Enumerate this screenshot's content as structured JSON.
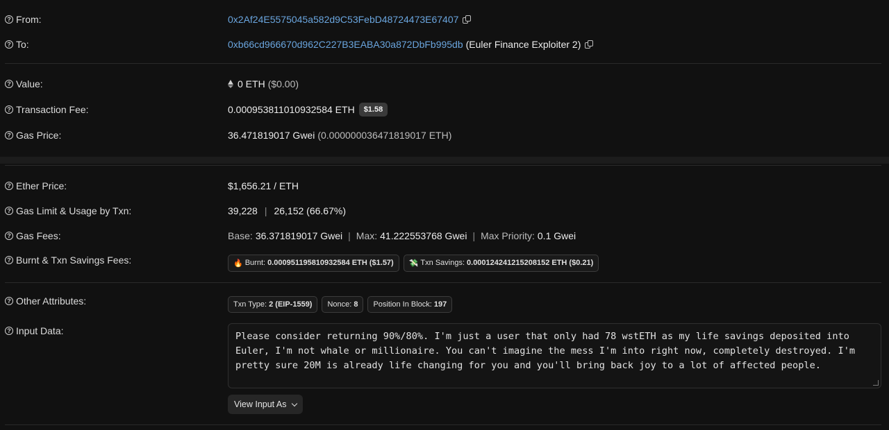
{
  "from": {
    "label": "From:",
    "address": "0x2Af24E5575045a582d9C53FebD48724473E67407"
  },
  "to": {
    "label": "To:",
    "address": "0xb66cd966670d962C227B3EABA30a872DbFb995db",
    "name": "(Euler Finance Exploiter 2)"
  },
  "value": {
    "label": "Value:",
    "amount": "0 ETH",
    "usd": "($0.00)"
  },
  "fee": {
    "label": "Transaction Fee:",
    "amount": "0.000953811010932584 ETH",
    "usd": "$1.58"
  },
  "gas_price": {
    "label": "Gas Price:",
    "gwei": "36.471819017 Gwei",
    "eth": "(0.000000036471819017 ETH)"
  },
  "ether_price": {
    "label": "Ether Price:",
    "value": "$1,656.21 / ETH"
  },
  "gas_limit": {
    "label": "Gas Limit & Usage by Txn:",
    "limit": "39,228",
    "sep": "|",
    "usage": "26,152 (66.67%)"
  },
  "gas_fees": {
    "label": "Gas Fees:",
    "base_label": "Base:",
    "base_value": "36.371819017 Gwei",
    "max_label": "Max:",
    "max_value": "41.222553768 Gwei",
    "priority_label": "Max Priority:",
    "priority_value": "0.1 Gwei",
    "sep": "|"
  },
  "burnt": {
    "label": "Burnt & Txn Savings Fees:",
    "burnt_label": "Burnt:",
    "burnt_value": "0.000951195810932584 ETH ($1.57)",
    "savings_label": "Txn Savings:",
    "savings_value": "0.000124241215208152 ETH ($0.21)"
  },
  "other": {
    "label": "Other Attributes:",
    "txn_type_label": "Txn Type:",
    "txn_type_value": "2 (EIP-1559)",
    "nonce_label": "Nonce:",
    "nonce_value": "8",
    "position_label": "Position In Block:",
    "position_value": "197"
  },
  "input": {
    "label": "Input Data:",
    "text": "Please consider returning 90%/80%. I'm just a user that only had 78 wstETH as my life savings deposited into Euler, I'm not whale or millionaire. You can't imagine the mess I'm into right now, completely destroyed. I'm pretty sure 20M is already life changing for you and you'll bring back joy to a lot of affected people.",
    "button": "View Input As"
  }
}
